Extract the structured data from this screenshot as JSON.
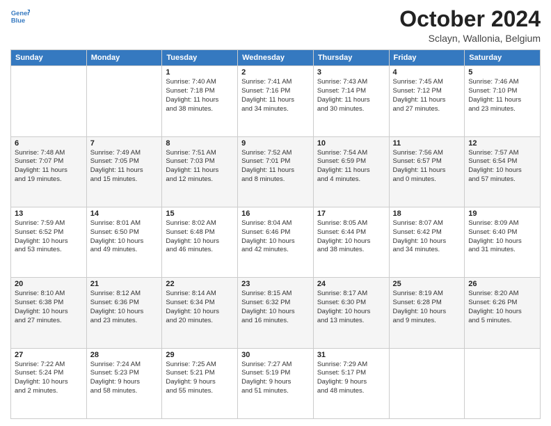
{
  "header": {
    "logo": {
      "line1": "General",
      "line2": "Blue"
    },
    "title": "October 2024",
    "location": "Sclayn, Wallonia, Belgium"
  },
  "weekdays": [
    "Sunday",
    "Monday",
    "Tuesday",
    "Wednesday",
    "Thursday",
    "Friday",
    "Saturday"
  ],
  "weeks": [
    [
      {
        "day": "",
        "info": ""
      },
      {
        "day": "",
        "info": ""
      },
      {
        "day": "1",
        "info": "Sunrise: 7:40 AM\nSunset: 7:18 PM\nDaylight: 11 hours\nand 38 minutes."
      },
      {
        "day": "2",
        "info": "Sunrise: 7:41 AM\nSunset: 7:16 PM\nDaylight: 11 hours\nand 34 minutes."
      },
      {
        "day": "3",
        "info": "Sunrise: 7:43 AM\nSunset: 7:14 PM\nDaylight: 11 hours\nand 30 minutes."
      },
      {
        "day": "4",
        "info": "Sunrise: 7:45 AM\nSunset: 7:12 PM\nDaylight: 11 hours\nand 27 minutes."
      },
      {
        "day": "5",
        "info": "Sunrise: 7:46 AM\nSunset: 7:10 PM\nDaylight: 11 hours\nand 23 minutes."
      }
    ],
    [
      {
        "day": "6",
        "info": "Sunrise: 7:48 AM\nSunset: 7:07 PM\nDaylight: 11 hours\nand 19 minutes."
      },
      {
        "day": "7",
        "info": "Sunrise: 7:49 AM\nSunset: 7:05 PM\nDaylight: 11 hours\nand 15 minutes."
      },
      {
        "day": "8",
        "info": "Sunrise: 7:51 AM\nSunset: 7:03 PM\nDaylight: 11 hours\nand 12 minutes."
      },
      {
        "day": "9",
        "info": "Sunrise: 7:52 AM\nSunset: 7:01 PM\nDaylight: 11 hours\nand 8 minutes."
      },
      {
        "day": "10",
        "info": "Sunrise: 7:54 AM\nSunset: 6:59 PM\nDaylight: 11 hours\nand 4 minutes."
      },
      {
        "day": "11",
        "info": "Sunrise: 7:56 AM\nSunset: 6:57 PM\nDaylight: 11 hours\nand 0 minutes."
      },
      {
        "day": "12",
        "info": "Sunrise: 7:57 AM\nSunset: 6:54 PM\nDaylight: 10 hours\nand 57 minutes."
      }
    ],
    [
      {
        "day": "13",
        "info": "Sunrise: 7:59 AM\nSunset: 6:52 PM\nDaylight: 10 hours\nand 53 minutes."
      },
      {
        "day": "14",
        "info": "Sunrise: 8:01 AM\nSunset: 6:50 PM\nDaylight: 10 hours\nand 49 minutes."
      },
      {
        "day": "15",
        "info": "Sunrise: 8:02 AM\nSunset: 6:48 PM\nDaylight: 10 hours\nand 46 minutes."
      },
      {
        "day": "16",
        "info": "Sunrise: 8:04 AM\nSunset: 6:46 PM\nDaylight: 10 hours\nand 42 minutes."
      },
      {
        "day": "17",
        "info": "Sunrise: 8:05 AM\nSunset: 6:44 PM\nDaylight: 10 hours\nand 38 minutes."
      },
      {
        "day": "18",
        "info": "Sunrise: 8:07 AM\nSunset: 6:42 PM\nDaylight: 10 hours\nand 34 minutes."
      },
      {
        "day": "19",
        "info": "Sunrise: 8:09 AM\nSunset: 6:40 PM\nDaylight: 10 hours\nand 31 minutes."
      }
    ],
    [
      {
        "day": "20",
        "info": "Sunrise: 8:10 AM\nSunset: 6:38 PM\nDaylight: 10 hours\nand 27 minutes."
      },
      {
        "day": "21",
        "info": "Sunrise: 8:12 AM\nSunset: 6:36 PM\nDaylight: 10 hours\nand 23 minutes."
      },
      {
        "day": "22",
        "info": "Sunrise: 8:14 AM\nSunset: 6:34 PM\nDaylight: 10 hours\nand 20 minutes."
      },
      {
        "day": "23",
        "info": "Sunrise: 8:15 AM\nSunset: 6:32 PM\nDaylight: 10 hours\nand 16 minutes."
      },
      {
        "day": "24",
        "info": "Sunrise: 8:17 AM\nSunset: 6:30 PM\nDaylight: 10 hours\nand 13 minutes."
      },
      {
        "day": "25",
        "info": "Sunrise: 8:19 AM\nSunset: 6:28 PM\nDaylight: 10 hours\nand 9 minutes."
      },
      {
        "day": "26",
        "info": "Sunrise: 8:20 AM\nSunset: 6:26 PM\nDaylight: 10 hours\nand 5 minutes."
      }
    ],
    [
      {
        "day": "27",
        "info": "Sunrise: 7:22 AM\nSunset: 5:24 PM\nDaylight: 10 hours\nand 2 minutes."
      },
      {
        "day": "28",
        "info": "Sunrise: 7:24 AM\nSunset: 5:23 PM\nDaylight: 9 hours\nand 58 minutes."
      },
      {
        "day": "29",
        "info": "Sunrise: 7:25 AM\nSunset: 5:21 PM\nDaylight: 9 hours\nand 55 minutes."
      },
      {
        "day": "30",
        "info": "Sunrise: 7:27 AM\nSunset: 5:19 PM\nDaylight: 9 hours\nand 51 minutes."
      },
      {
        "day": "31",
        "info": "Sunrise: 7:29 AM\nSunset: 5:17 PM\nDaylight: 9 hours\nand 48 minutes."
      },
      {
        "day": "",
        "info": ""
      },
      {
        "day": "",
        "info": ""
      }
    ]
  ]
}
